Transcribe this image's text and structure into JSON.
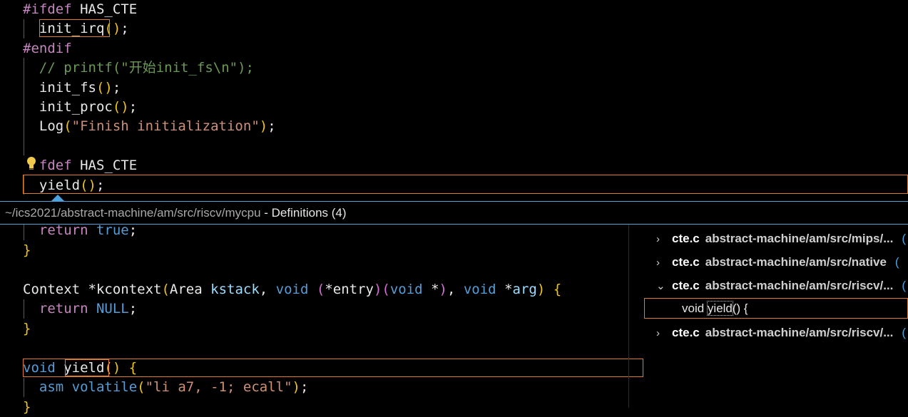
{
  "editor_top": {
    "lines": [
      {
        "parts": [
          {
            "t": "#ifdef",
            "c": "kw-pre"
          },
          {
            "t": " HAS_CTE",
            "c": "fn"
          }
        ]
      },
      {
        "parts": [
          {
            "t": "  init_irq",
            "c": "fn"
          },
          {
            "t": "()",
            "c": "paren"
          },
          {
            "t": ";",
            "c": "fn"
          }
        ]
      },
      {
        "parts": [
          {
            "t": "#endif",
            "c": "kw-pre"
          }
        ]
      },
      {
        "parts": [
          {
            "t": "  // printf(\"开始init_fs\\n\");",
            "c": "comment"
          }
        ]
      },
      {
        "parts": [
          {
            "t": "  init_fs",
            "c": "fn"
          },
          {
            "t": "()",
            "c": "paren"
          },
          {
            "t": ";",
            "c": "fn"
          }
        ]
      },
      {
        "parts": [
          {
            "t": "  init_proc",
            "c": "fn"
          },
          {
            "t": "()",
            "c": "paren"
          },
          {
            "t": ";",
            "c": "fn"
          }
        ]
      },
      {
        "parts": [
          {
            "t": "  Log",
            "c": "fn"
          },
          {
            "t": "(",
            "c": "paren"
          },
          {
            "t": "\"Finish initialization\"",
            "c": "str"
          },
          {
            "t": ")",
            "c": "paren"
          },
          {
            "t": ";",
            "c": "fn"
          }
        ]
      },
      {
        "parts": []
      },
      {
        "parts": [
          {
            "t": "  fdef",
            "c": "kw-pre"
          },
          {
            "t": " HAS_CTE",
            "c": "fn"
          }
        ]
      },
      {
        "parts": [
          {
            "t": "  yield",
            "c": "fn"
          },
          {
            "t": "()",
            "c": "paren"
          },
          {
            "t": ";",
            "c": "fn"
          }
        ]
      }
    ]
  },
  "peek": {
    "path": "~/ics2021/abstract-machine/am/src/riscv/mycpu",
    "separator": " - ",
    "title": "Definitions (4)"
  },
  "peek_code": {
    "lines": [
      {
        "parts": [
          {
            "t": "  return",
            "c": "kw-pre"
          },
          {
            "t": " true",
            "c": "kw"
          },
          {
            "t": ";",
            "c": "fn"
          }
        ]
      },
      {
        "parts": [
          {
            "t": "}",
            "c": "paren"
          }
        ]
      },
      {
        "parts": []
      },
      {
        "parts": [
          {
            "t": "Context",
            "c": "type"
          },
          {
            "t": " *kcontext",
            "c": "fn"
          },
          {
            "t": "(",
            "c": "paren"
          },
          {
            "t": "Area ",
            "c": "type"
          },
          {
            "t": "kstack",
            "c": "param"
          },
          {
            "t": ", ",
            "c": "fn"
          },
          {
            "t": "void",
            "c": "kw"
          },
          {
            "t": " ",
            "c": "fn"
          },
          {
            "t": "(",
            "c": "paren2"
          },
          {
            "t": "*entry",
            "c": "fn"
          },
          {
            "t": ")(",
            "c": "paren2"
          },
          {
            "t": "void",
            "c": "kw"
          },
          {
            "t": " *",
            "c": "fn"
          },
          {
            "t": ")",
            "c": "paren2"
          },
          {
            "t": ", ",
            "c": "fn"
          },
          {
            "t": "void",
            "c": "kw"
          },
          {
            "t": " *",
            "c": "fn"
          },
          {
            "t": "arg",
            "c": "param"
          },
          {
            "t": ")",
            "c": "paren"
          },
          {
            "t": " {",
            "c": "paren"
          }
        ]
      },
      {
        "parts": [
          {
            "t": "  return",
            "c": "kw-pre"
          },
          {
            "t": " NULL",
            "c": "kw"
          },
          {
            "t": ";",
            "c": "fn"
          }
        ]
      },
      {
        "parts": [
          {
            "t": "}",
            "c": "paren"
          }
        ]
      },
      {
        "parts": []
      },
      {
        "parts": [
          {
            "t": "void",
            "c": "kw"
          },
          {
            "t": " yield",
            "c": "fn"
          },
          {
            "t": "()",
            "c": "paren"
          },
          {
            "t": " {",
            "c": "paren"
          }
        ]
      },
      {
        "parts": [
          {
            "t": "  asm ",
            "c": "kw"
          },
          {
            "t": "volatile",
            "c": "kw"
          },
          {
            "t": "(",
            "c": "paren"
          },
          {
            "t": "\"li a7, -1; ecall\"",
            "c": "str"
          },
          {
            "t": ")",
            "c": "paren"
          },
          {
            "t": ";",
            "c": "fn"
          }
        ]
      },
      {
        "parts": [
          {
            "t": "}",
            "c": "paren"
          }
        ]
      }
    ]
  },
  "references": [
    {
      "chevron": "›",
      "file": "cte.c",
      "path": "abstract-machine/am/src/mips/...",
      "dot": "("
    },
    {
      "chevron": "›",
      "file": "cte.c",
      "path": "abstract-machine/am/src/native",
      "dot": "("
    },
    {
      "chevron": "⌄",
      "file": "cte.c",
      "path": "abstract-machine/am/src/riscv/...",
      "dot": "("
    },
    {
      "chevron": "›",
      "file": "cte.c",
      "path": "abstract-machine/am/src/riscv/...",
      "dot": "("
    }
  ],
  "reference_child": {
    "pre": "void ",
    "word": "yield",
    "post": "() {"
  },
  "colors": {
    "accent": "#4aa3df",
    "highlight": "#e07b2a",
    "background": "#000000"
  }
}
